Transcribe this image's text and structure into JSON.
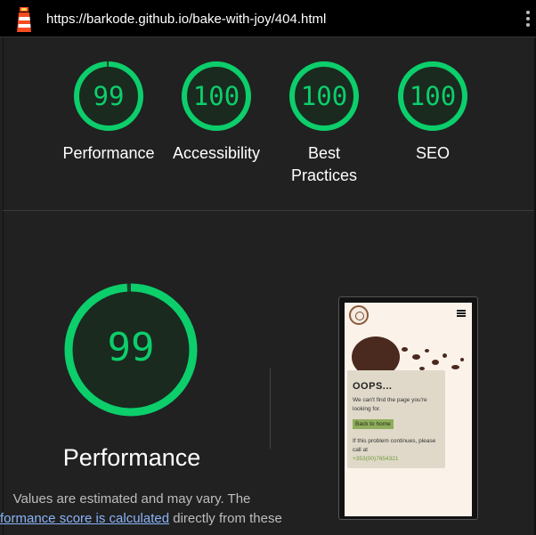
{
  "topbar": {
    "url": "https://barkode.github.io/bake-with-joy/404.html",
    "logo_icon": "lighthouse-icon",
    "menu_icon": "more-vert-icon"
  },
  "colors": {
    "pass": "#0cce6b",
    "background": "#212121",
    "link": "#8ab4f8"
  },
  "gauges": [
    {
      "score": "99",
      "label": "Performance",
      "value": 0.99
    },
    {
      "score": "100",
      "label": "Accessibility",
      "value": 1.0
    },
    {
      "score": "100",
      "label_line1": "Best",
      "label_line2": "Practices",
      "value": 1.0
    },
    {
      "score": "100",
      "label": "SEO",
      "value": 1.0
    }
  ],
  "performance": {
    "score": "99",
    "value": 0.99,
    "title": "Performance",
    "note_line1": "Values are estimated and may vary. The",
    "note_link": "formance score is calculated",
    "note_tail": " directly from these"
  },
  "preview": {
    "heading": "OOPS...",
    "message": "We can't find the page you're looking for.",
    "button": "Back to home",
    "message2": "If this problem continues, please call at",
    "phone": "+353(00)7654321"
  }
}
